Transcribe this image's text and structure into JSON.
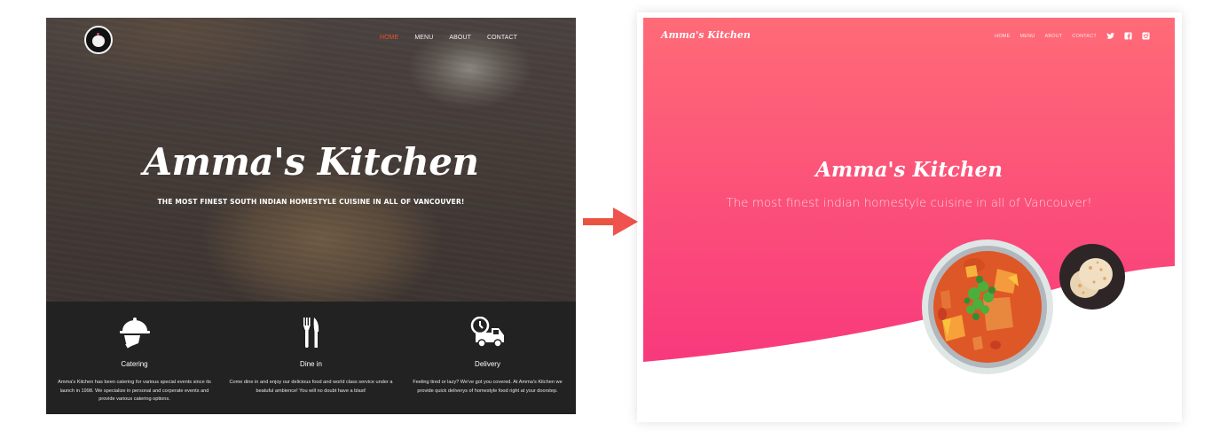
{
  "before": {
    "logo_icon": "woman-face-logo-icon",
    "nav": [
      {
        "label": "HOME",
        "active": true
      },
      {
        "label": "MENU",
        "active": false
      },
      {
        "label": "ABOUT",
        "active": false
      },
      {
        "label": "CONTACT",
        "active": false
      }
    ],
    "hero_title": "Amma's Kitchen",
    "hero_subtitle": "THE MOST FINEST SOUTH INDIAN HOMESTYLE CUISINE IN ALL OF VANCOUVER!",
    "features": [
      {
        "icon": "cloche-serving-icon",
        "title": "Catering",
        "description": "Amma's Kitchen has been catering for various special events since its launch in 1998. We specialize in personal and corperate events and provide various catering options."
      },
      {
        "icon": "fork-knife-icon",
        "title": "Dine in",
        "description": "Come dine in and enjoy our delicious food and world class service under a beatuful ambience! You will no doubt have a blast!"
      },
      {
        "icon": "delivery-truck-clock-icon",
        "title": "Delivery",
        "description": "Feeling tired or lazy? We've got you covered. At Amma's Kitchen we provide quick deliverys of homestyle food right at your doorstep."
      }
    ],
    "colors": {
      "active_nav": "#e8512a",
      "footer_bg": "#222222"
    }
  },
  "arrow_icon": "right-arrow-icon",
  "after": {
    "logo": "Amma's Kitchen",
    "nav": [
      {
        "label": "HOME"
      },
      {
        "label": "MENU"
      },
      {
        "label": "ABOUT"
      },
      {
        "label": "CONTACT"
      }
    ],
    "social": [
      {
        "icon": "twitter-icon"
      },
      {
        "icon": "facebook-icon"
      },
      {
        "icon": "instagram-icon"
      }
    ],
    "hero_title": "Amma's Kitchen",
    "hero_subtitle": "The most finest indian homestyle cuisine in all of Vancouver!",
    "illustrations": [
      "curry-bowl-illustration",
      "roti-plate-illustration"
    ],
    "colors": {
      "gradient_top": "#ff6b77",
      "gradient_bottom": "#f8397c",
      "arrow": "#ee4d4d"
    }
  }
}
